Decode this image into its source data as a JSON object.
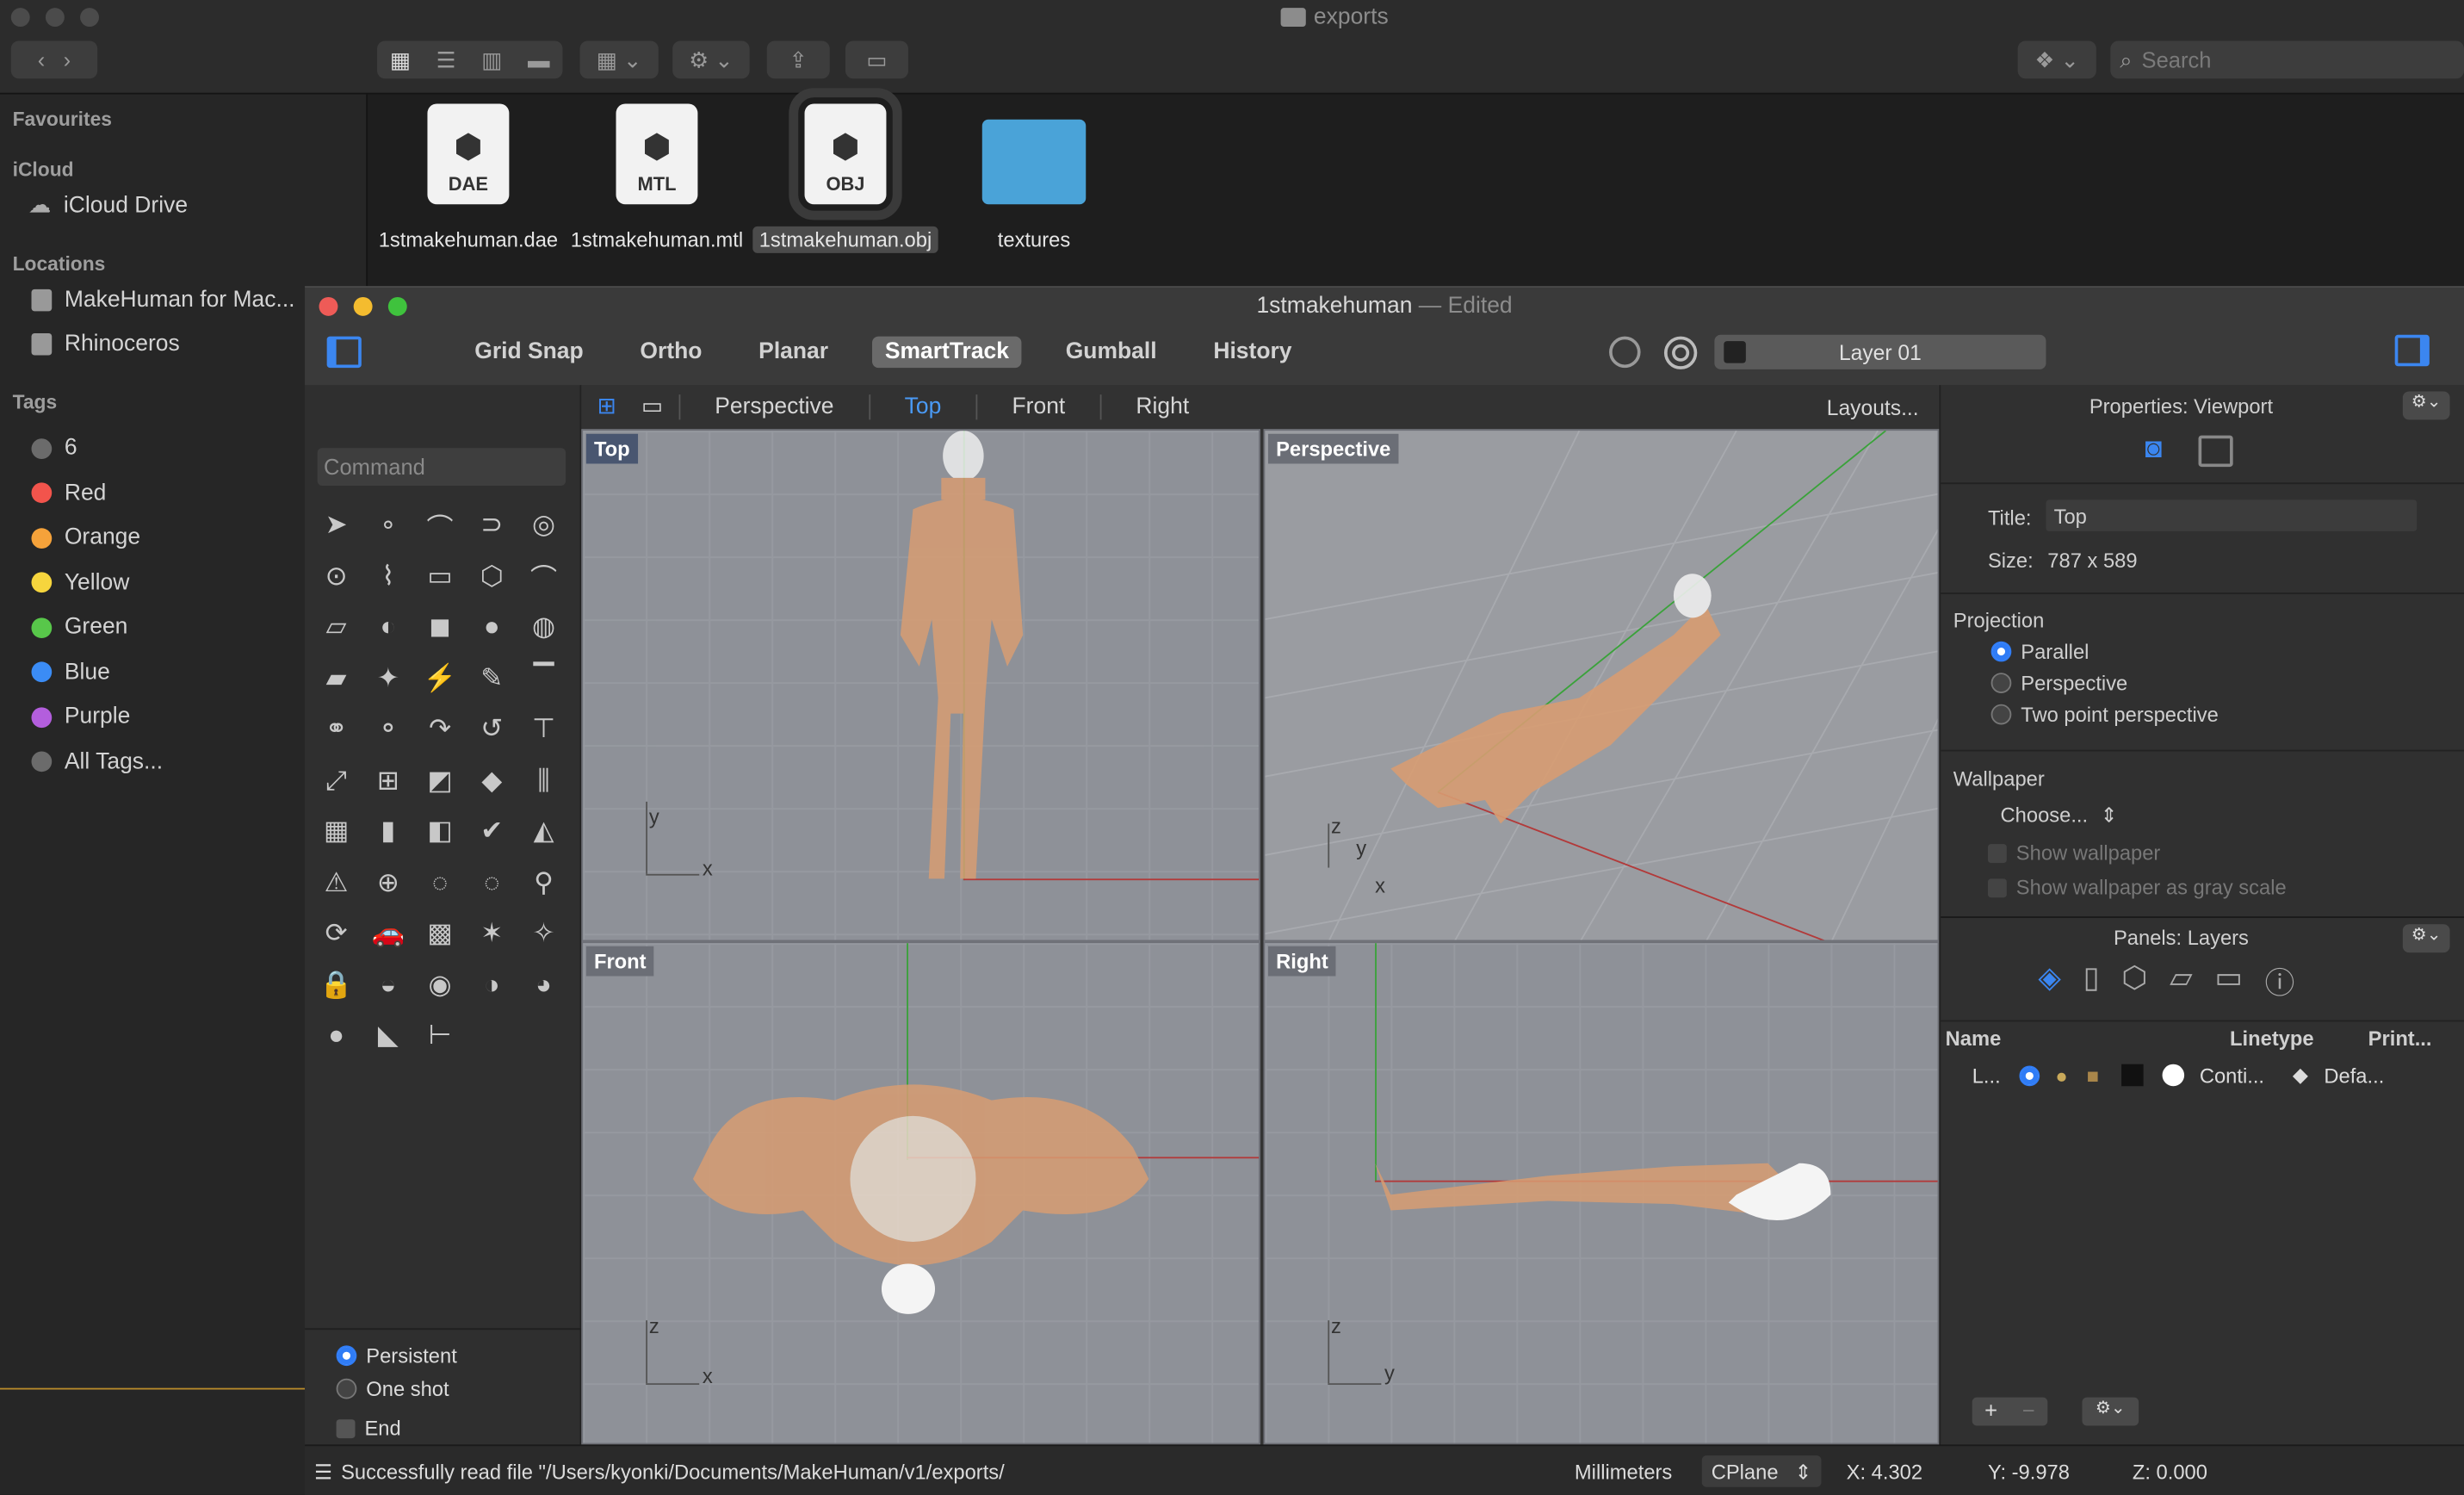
{
  "finder": {
    "title": "exports",
    "search_placeholder": "Search",
    "sidebar": {
      "favourites": "Favourites",
      "icloud": "iCloud",
      "icloud_drive": "iCloud Drive",
      "locations": "Locations",
      "loc1": "MakeHuman for Mac...",
      "loc2": "Rhinoceros",
      "tags": "Tags",
      "tag_items": [
        "6",
        "Red",
        "Orange",
        "Yellow",
        "Green",
        "Blue",
        "Purple",
        "All Tags..."
      ],
      "tag_colors": [
        "#6b6b6b",
        "#f2544c",
        "#f5a23a",
        "#f6d53d",
        "#58c74a",
        "#3b8cf5",
        "#b35edd",
        "#6b6b6b"
      ]
    },
    "files": [
      {
        "ext": "DAE",
        "name": "1stmakehuman.dae"
      },
      {
        "ext": "MTL",
        "name": "1stmakehuman.mtl"
      },
      {
        "ext": "OBJ",
        "name": "1stmakehuman.obj"
      },
      {
        "ext": "",
        "name": "textures"
      }
    ]
  },
  "rhino": {
    "title": "1stmakehuman",
    "title_suffix": " — Edited",
    "toolbar": [
      "Grid Snap",
      "Ortho",
      "Planar",
      "SmartTrack",
      "Gumball",
      "History"
    ],
    "active_toolbar": "SmartTrack",
    "layer": "Layer 01",
    "command_placeholder": "Command",
    "view_tabs": [
      "Perspective",
      "Top",
      "Front",
      "Right"
    ],
    "active_tab": "Top",
    "layouts": "Layouts...",
    "viewports": {
      "top": "Top",
      "perspective": "Perspective",
      "front": "Front",
      "right": "Right"
    },
    "axes": {
      "x": "x",
      "y": "y",
      "z": "z"
    },
    "options": {
      "persistent": "Persistent",
      "one_shot": "One shot",
      "end": "End"
    },
    "properties": {
      "header": "Properties: Viewport",
      "title_label": "Title:",
      "title_value": "Top",
      "size_label": "Size:",
      "size_value": "787 x 589",
      "projection": "Projection",
      "proj_options": [
        "Parallel",
        "Perspective",
        "Two point perspective"
      ],
      "wallpaper": "Wallpaper",
      "choose": "Choose...",
      "show_wallpaper": "Show wallpaper",
      "show_gray": "Show wallpaper as gray scale"
    },
    "layers": {
      "header": "Panels: Layers",
      "col_name": "Name",
      "col_linetype": "Linetype",
      "col_print": "Print...",
      "row_name": "L...",
      "row_linetype": "Conti...",
      "row_print": "Defa..."
    },
    "status": {
      "message": "Successfully read file \"/Users/kyonki/Documents/MakeHuman/v1/exports/",
      "units": "Millimeters",
      "cplane": "CPlane",
      "x": "X: 4.302",
      "y": "Y: -9.978",
      "z": "Z: 0.000"
    }
  }
}
